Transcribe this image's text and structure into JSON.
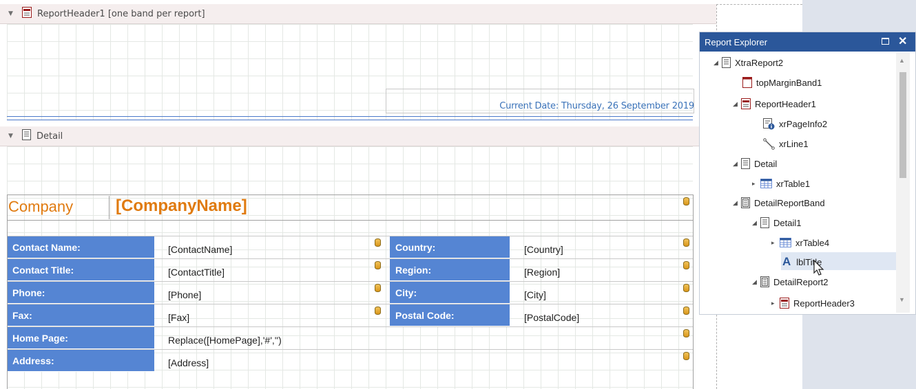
{
  "report_header": {
    "title": "ReportHeader1 [one band per report]"
  },
  "page_info": {
    "text": "Current Date: Thursday, 26 September 2019"
  },
  "detail_band": {
    "title": "Detail"
  },
  "company": {
    "label": "Company",
    "field": "[CompanyName]"
  },
  "table_rows": [
    {
      "label": "Contact Name:",
      "value": "[ContactName]",
      "label2": "Country:",
      "value2": "[Country]"
    },
    {
      "label": "Contact Title:",
      "value": "[ContactTitle]",
      "label2": "Region:",
      "value2": "[Region]"
    },
    {
      "label": "Phone:",
      "value": "[Phone]",
      "label2": "City:",
      "value2": "[City]"
    },
    {
      "label": "Fax:",
      "value": "[Fax]",
      "label2": "Postal Code:",
      "value2": "[PostalCode]"
    },
    {
      "label": "Home Page:",
      "value": "Replace([HomePage],'#','')"
    },
    {
      "label": "Address:",
      "value": "[Address]"
    }
  ],
  "explorer": {
    "title": "Report Explorer",
    "items": [
      {
        "label": "XtraReport2",
        "icon": "report-icon"
      },
      {
        "label": "topMarginBand1",
        "icon": "margin-band-icon"
      },
      {
        "label": "ReportHeader1",
        "icon": "header-band-icon"
      },
      {
        "label": "xrPageInfo2",
        "icon": "page-info-icon"
      },
      {
        "label": "xrLine1",
        "icon": "line-icon"
      },
      {
        "label": "Detail",
        "icon": "detail-band-icon"
      },
      {
        "label": "xrTable1",
        "icon": "table-icon"
      },
      {
        "label": "DetailReportBand",
        "icon": "detail-report-icon"
      },
      {
        "label": "Detail1",
        "icon": "detail-band-icon"
      },
      {
        "label": "xrTable4",
        "icon": "table-icon"
      },
      {
        "label": "lblTitle",
        "icon": "label-icon"
      },
      {
        "label": "DetailReport2",
        "icon": "detail-report-icon"
      },
      {
        "label": "ReportHeader3",
        "icon": "header-band-icon"
      }
    ]
  },
  "colors": {
    "accent": "#2b579a",
    "label_bg": "#5585d3",
    "company": "#e07b10"
  }
}
